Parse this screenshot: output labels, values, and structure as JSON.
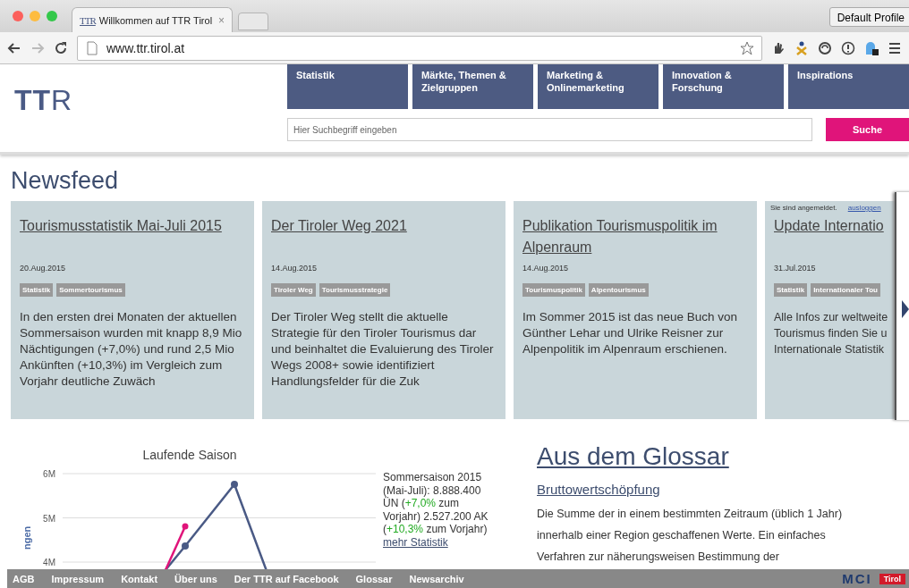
{
  "browser": {
    "tab": {
      "favicon_text": "TTR",
      "title": "Willkommen auf TTR Tirol",
      "close": "×"
    },
    "profile": "Default Profile",
    "url": "www.ttr.tirol.at"
  },
  "header": {
    "logo": {
      "bold": "TT",
      "light": "R"
    },
    "nav": [
      {
        "label": "Statistik"
      },
      {
        "label": "Märkte, Themen & Zielgruppen"
      },
      {
        "label": "Marketing & Onlinemarketing"
      },
      {
        "label": "Innovation & Forschung"
      },
      {
        "label": "Inspirations"
      }
    ],
    "search": {
      "placeholder": "Hier Suchbegriff eingeben",
      "button": "Suche"
    }
  },
  "newsfeed": {
    "heading": "Newsfeed",
    "cards": [
      {
        "title": "Tourismusstatistik Mai-Juli 2015",
        "date": "20.Aug.2015",
        "tags": [
          "Statistik",
          "Sommertourismus"
        ],
        "text": "In den ersten drei Monaten der aktuellen Sommersaison wurden mit knapp 8,9 Mio Nächtigungen (+7,0%) und rund 2,5 Mio Ankünften (+10,3%) im Vergleich zum Vorjahr deutliche Zuwäch"
      },
      {
        "title": "Der Tiroler Weg 2021",
        "date": "14.Aug.2015",
        "tags": [
          "Tiroler Weg",
          "Tourismusstrategie"
        ],
        "text": "Der Tiroler Weg stellt die aktuelle Strategie für den Tiroler Tourismus dar und beinhaltet die Evaluierung des Tiroler Wegs 2008+ sowie identifiziert Handlungsfelder für die Zuk"
      },
      {
        "title": "Publikation Tourismuspolitik im Alpenraum",
        "date": "14.Aug.2015",
        "tags": [
          "Tourismuspolitik",
          "Alpentourismus"
        ],
        "text": "Im Sommer 2015 ist das neue Buch von Günther Lehar und Ulrike Reisner zur Alpenpolitik im Alpenraum erschienen."
      },
      {
        "title": "Update Internatio",
        "date": "31.Jul.2015",
        "tags": [
          "Statistik",
          "Internationaler Tou"
        ],
        "text": "Alle Infos zur weltweite Tourismus finden Sie u Internationale Statistik"
      }
    ]
  },
  "login_notice": {
    "text": "Sie sind angemeldet.",
    "link": "ausloggen"
  },
  "season": {
    "chart": {
      "title": "Laufende Saison",
      "ylabel": "ngen",
      "tick_labels": [
        "6M",
        "5M",
        "4M"
      ]
    },
    "stats": [
      {
        "kind": "plain",
        "text": "Sommersaison 2015 (Mai-Juli): 8.888.400 ÜN ("
      },
      {
        "kind": "change",
        "text": "+7,0%"
      },
      {
        "kind": "plain",
        "text": " zum Vorjahr) 2.527.200 AK ("
      },
      {
        "kind": "change",
        "text": "+10,3%"
      },
      {
        "kind": "plain",
        "text": " zum Vorjahr)"
      }
    ],
    "link": "mehr Statistik"
  },
  "glossary": {
    "heading": "Aus dem Glossar",
    "term": "Bruttowertschöpfung",
    "text": "Die Summe der in einem bestimmten Zeitraum (üblich 1 Jahr) innerhalb einer Region geschaffenen Werte. Ein einfaches Verfahren zur näherungsweisen Bestimmung der"
  },
  "footer": {
    "links": [
      "AGB",
      "Impressum",
      "Kontakt",
      "Über uns",
      "Der TTR auf Facebook",
      "Glossar",
      "Newsarchiv"
    ],
    "logos": [
      {
        "kind": "mci",
        "text": "MCI"
      },
      {
        "kind": "tirol",
        "text": "Tirol"
      }
    ]
  }
}
